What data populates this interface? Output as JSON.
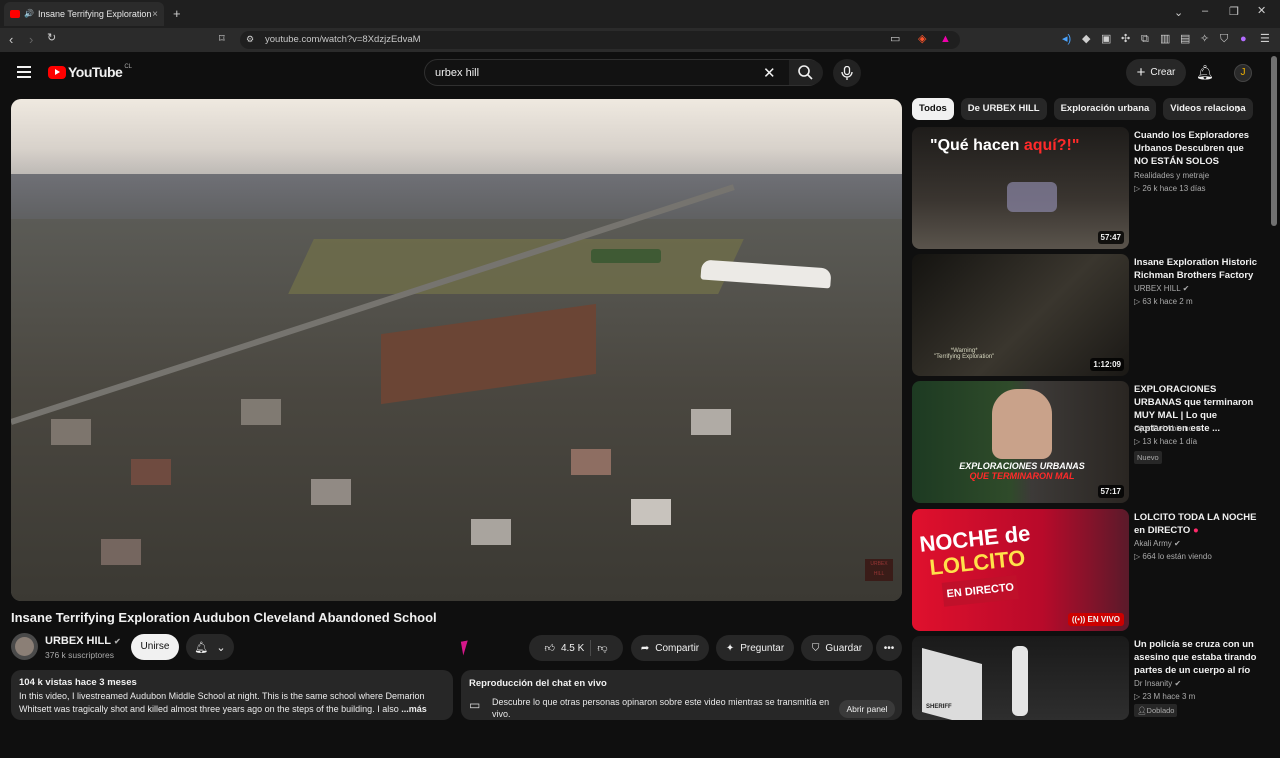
{
  "browser": {
    "tab_title": "Insane Terrifying Exploration",
    "url": "youtube.com/watch?v=8XdzjzEdvaM"
  },
  "header": {
    "logo_text": "YouTube",
    "country": "CL",
    "search_value": "urbex hill",
    "create_label": "Crear",
    "avatar_letter": "J"
  },
  "video": {
    "title": "Insane Terrifying Exploration Audubon Cleveland Abandoned School",
    "channel_name": "URBEX HILL",
    "subscribers": "376 k suscriptores",
    "join_label": "Unirse",
    "likes": "4.5 K",
    "share_label": "Compartir",
    "ask_label": "Preguntar",
    "save_label": "Guardar",
    "watermark": "URBEX HILL"
  },
  "description": {
    "meta": "104 k vistas  hace 3 meses",
    "text": "In this video, I livestreamed Audubon Middle School at night. This is the same school where Demarion Whitsett was tragically shot and killed almost three years ago on the steps of the building. I also",
    "more": "...más"
  },
  "chat": {
    "title": "Reproducción del chat en vivo",
    "text": "Descubre lo que otras personas opinaron sobre este video mientras se transmitía en vivo.",
    "button": "Abrir panel"
  },
  "chips": [
    "Todos",
    "De URBEX HILL",
    "Exploración urbana",
    "Videos relaciona"
  ],
  "related": [
    {
      "title": "Cuando los Exploradores Urbanos Descubren que NO ESTÁN SOLOS",
      "channel": "Realidades y metraje",
      "stats": "▷ 26 k  hace 13 días",
      "duration": "57:47",
      "thumb_text_1": "\"Qué hacen ",
      "thumb_text_2": "aquí?!\""
    },
    {
      "title": "Insane Exploration Historic Richman Brothers Factory",
      "channel": "URBEX HILL",
      "stats": "▷ 63 k  hace 2 m",
      "duration": "1:12:09",
      "thumb_text_1": "*Warning*",
      "thumb_text_2": "\"Terrifying Exploration\""
    },
    {
      "title": "EXPLORACIONES URBANAS que terminaron MUY MAL | Lo que captaron en este ...",
      "channel": "Ojos Del Abismo",
      "stats": "▷ 13 k  hace 1 día",
      "badge": "Nuevo",
      "duration": "57:17",
      "thumb_text_1": "EXPLORACIONES URBANAS",
      "thumb_text_2": "QUE TERMINARON MAL"
    },
    {
      "title": "LOLCITO TODA LA NOCHE en DIRECTO",
      "channel": "Akali Army",
      "stats": "▷ 664 lo están viendo",
      "live": "EN VIVO",
      "thumb_text_1": "NOCHE de",
      "thumb_text_2": "LOLCITO",
      "thumb_text_3": "EN DIRECTO"
    },
    {
      "title": "Un policía se cruza con un asesino que estaba tirando partes de un cuerpo al río",
      "channel": "Dr Insanity",
      "stats": "▷ 23 M  hace 3 m",
      "badge": "Doblado",
      "thumb_text_1": "SHERIFF"
    }
  ],
  "colors": {
    "background": "#0f0f0f",
    "accent": "#ff0000",
    "surface": "#272727"
  }
}
